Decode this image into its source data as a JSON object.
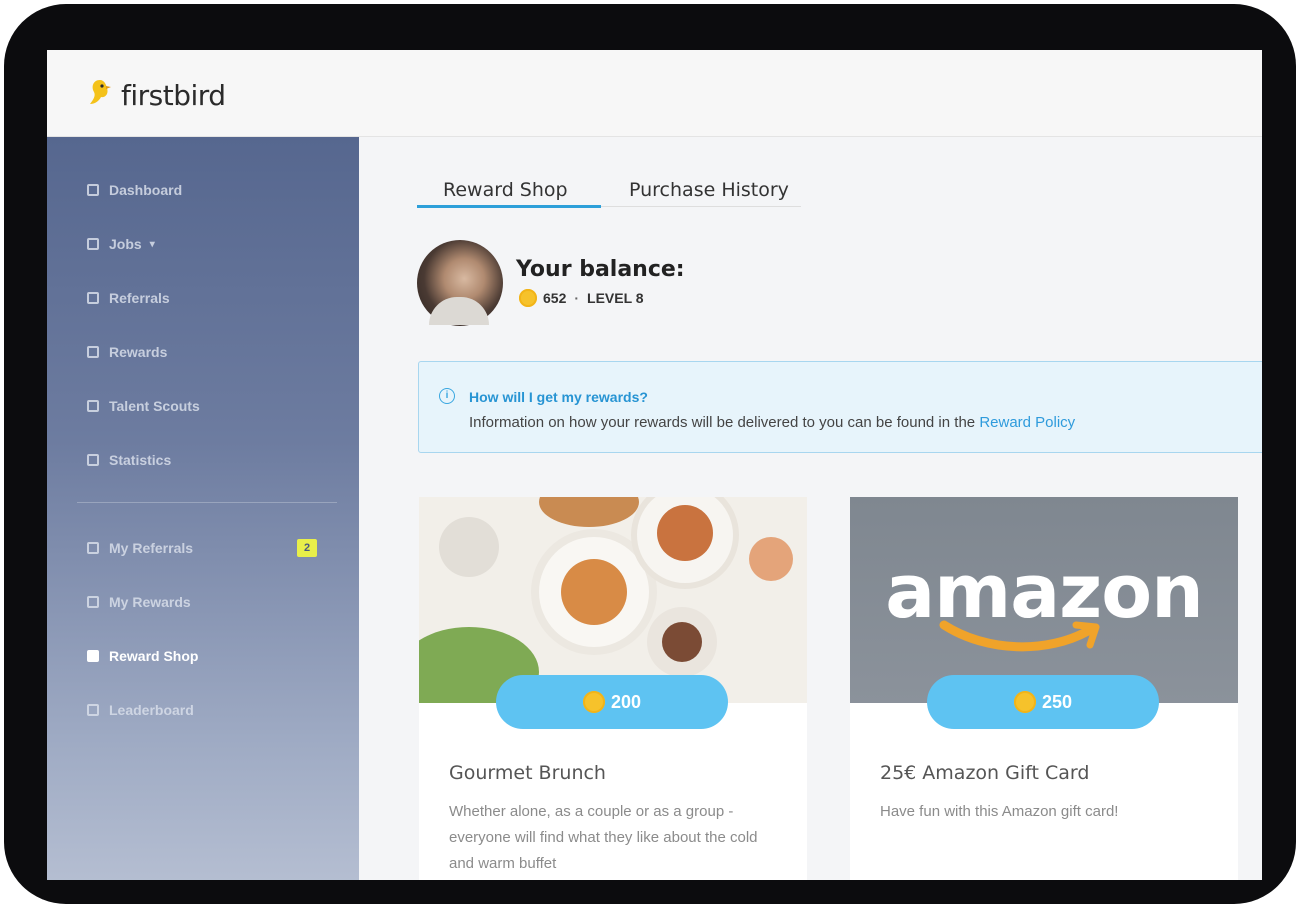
{
  "app": {
    "logo_text": "firstbird"
  },
  "sidebar": {
    "items": [
      {
        "label": "Dashboard",
        "icon": "dashboard-icon"
      },
      {
        "label": "Jobs",
        "icon": "briefcase-icon"
      },
      {
        "label": "Referrals",
        "icon": "referrals-icon"
      },
      {
        "label": "Rewards",
        "icon": "trophy-icon"
      },
      {
        "label": "Talent Scouts",
        "icon": "users-icon"
      },
      {
        "label": "Statistics",
        "icon": "chart-icon"
      },
      {
        "label": "My Referrals",
        "icon": "thumb-icon",
        "badge": "2"
      },
      {
        "label": "My Rewards",
        "icon": "gift-icon"
      },
      {
        "label": "Reward Shop",
        "icon": "shop-icon",
        "active": true
      },
      {
        "label": "Leaderboard",
        "icon": "leaderboard-icon"
      }
    ]
  },
  "tabs": [
    {
      "label": "Reward Shop",
      "active": true
    },
    {
      "label": "Purchase History",
      "active": false
    }
  ],
  "balance": {
    "title": "Your balance:",
    "points": "652",
    "separator": "·",
    "level": "LEVEL 8"
  },
  "info": {
    "title": "How will I get my rewards?",
    "text": "Information on how your rewards will be delivered to you can be found in the",
    "link": "Reward Policy"
  },
  "products": [
    {
      "price": "200",
      "title": "Gourmet Brunch",
      "description": "Whether alone, as a couple or as a group - everyone will find what they like about the cold and warm buffet"
    },
    {
      "price": "250",
      "title": "25€ Amazon Gift Card",
      "description": "Have fun with this Amazon gift card!",
      "brand_text": "amazon"
    }
  ],
  "colors": {
    "accent": "#2d9fd9",
    "price_pill": "#5ec3f2",
    "coin": "#f6c22b",
    "badge": "#e8ef4a",
    "amazon_smile": "#f0a32a"
  }
}
